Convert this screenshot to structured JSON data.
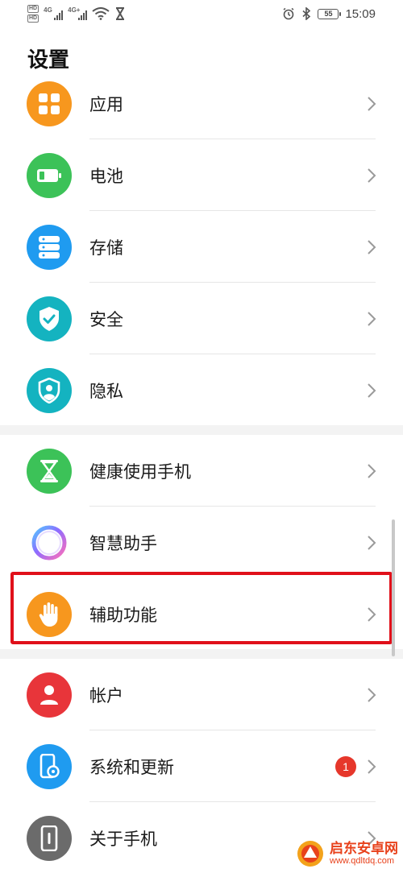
{
  "status_bar": {
    "network_1": "4G",
    "network_2": "4G+",
    "battery": "55",
    "time": "15:09"
  },
  "page_title": "设置",
  "section_1": [
    {
      "label": "应用",
      "icon": "apps-grid-icon",
      "color": "#f7971e"
    },
    {
      "label": "电池",
      "icon": "battery-icon",
      "color": "#3cc258"
    },
    {
      "label": "存储",
      "icon": "storage-icon",
      "color": "#1f9bf0"
    },
    {
      "label": "安全",
      "icon": "shield-check-icon",
      "color": "#14b3c0"
    },
    {
      "label": "隐私",
      "icon": "privacy-shield-icon",
      "color": "#14b3c0"
    }
  ],
  "section_2": [
    {
      "label": "健康使用手机",
      "icon": "hourglass-icon",
      "color": "#3cc258"
    },
    {
      "label": "智慧助手",
      "icon": "assistant-ring-icon",
      "color": "#ffffff"
    },
    {
      "label": "辅助功能",
      "icon": "hand-icon",
      "color": "#f7971e"
    }
  ],
  "section_3": [
    {
      "label": "帐户",
      "icon": "account-icon",
      "color": "#e8353a"
    },
    {
      "label": "系统和更新",
      "icon": "system-update-icon",
      "color": "#1f9bf0",
      "badge": "1"
    },
    {
      "label": "关于手机",
      "icon": "about-phone-icon",
      "color": "#6b6b6b"
    }
  ],
  "watermark": {
    "name": "启东安卓网",
    "url": "www.qdltdq.com"
  }
}
